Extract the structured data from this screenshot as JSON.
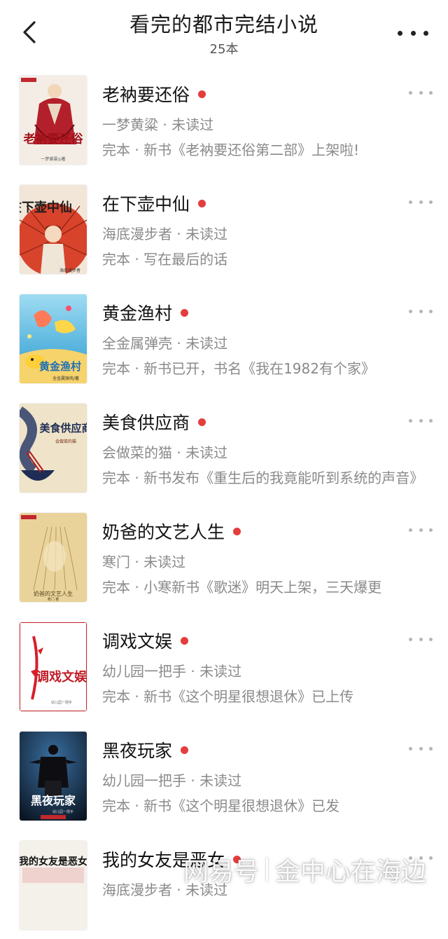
{
  "header": {
    "title": "看完的都市完结小说",
    "count": "25本",
    "back_icon": "chevron-left-icon",
    "more_icon": "more-dots-icon"
  },
  "books": [
    {
      "title": "老衲要还俗",
      "meta": "一梦黄粱 · 未读过",
      "update": "完本 · 新书《老衲要还俗第二部》上架啦!",
      "cover_text": "老衲要还俗",
      "cover_author": "一梦黄粱◎著",
      "has_new": true
    },
    {
      "title": "在下壶中仙",
      "meta": "海底漫步者 · 未读过",
      "update": "完本 · 写在最后的话",
      "cover_text": "在下壶中仙",
      "cover_author": "海底漫步者",
      "has_new": true
    },
    {
      "title": "黄金渔村",
      "meta": "全金属弹壳 · 未读过",
      "update": "完本 · 新书已开，书名《我在1982有个家》",
      "cover_text": "黄金渔村",
      "cover_author": "全金属弹壳/著",
      "has_new": true
    },
    {
      "title": "美食供应商",
      "meta": "会做菜的猫 · 未读过",
      "update": "完本 · 新书发布《重生后的我竟能听到系统的声音》",
      "cover_text": "美食供应商",
      "cover_author": "会做菜的猫",
      "has_new": true
    },
    {
      "title": "奶爸的文艺人生",
      "meta": "寒门 · 未读过",
      "update": "完本 · 小寒新书《歌迷》明天上架，三天爆更",
      "cover_text": "奶爸的文艺人生",
      "cover_author": "寒门 著",
      "has_new": true
    },
    {
      "title": "调戏文娱",
      "meta": "幼儿园一把手 · 未读过",
      "update": "完本 · 新书《这个明星很想退休》已上传",
      "cover_text": "调戏文娱",
      "cover_author": "幼儿园一把手",
      "has_new": true
    },
    {
      "title": "黑夜玩家",
      "meta": "幼儿园一把手 · 未读过",
      "update": "完本 · 新书《这个明星很想退休》已发",
      "cover_text": "黑夜玩家",
      "cover_author": "幼儿园一把手",
      "has_new": true
    },
    {
      "title": "我的女友是恶女",
      "meta": "海底漫步者 · 未读过",
      "update": "",
      "cover_text": "我的女友是恶女",
      "cover_author": "",
      "has_new": true
    }
  ],
  "watermark": {
    "left": "网易号",
    "right": "金中心在海边"
  },
  "colors": {
    "new_dot": "#e33d3d",
    "meta_text": "#8a8a8a",
    "title_text": "#111111"
  }
}
